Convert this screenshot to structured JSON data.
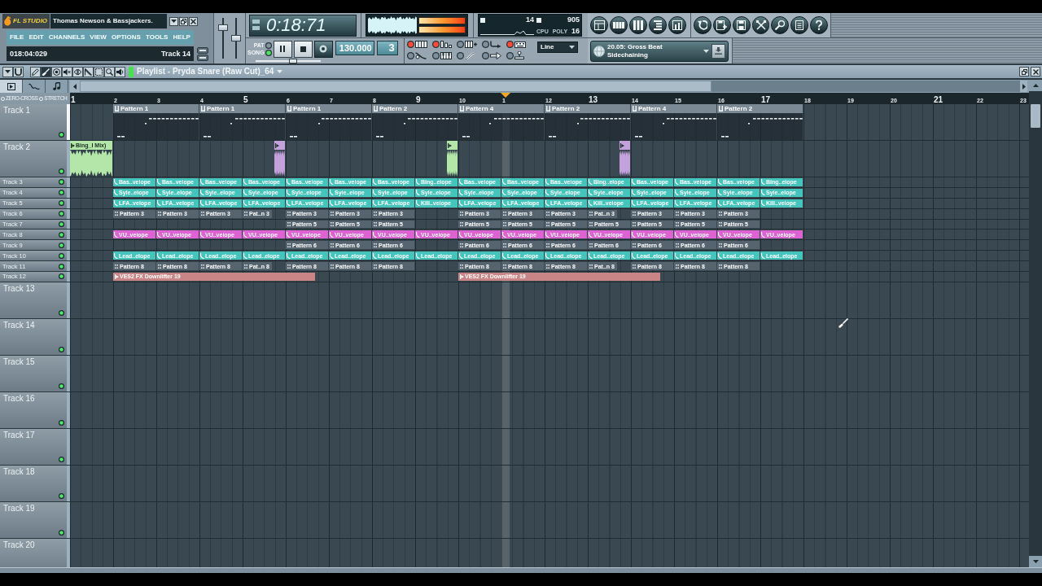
{
  "toolbar": {
    "logo": "FL STUDIO",
    "title": "Thomas Newson & Bassjackers.",
    "menu": [
      "FILE",
      "EDIT",
      "CHANNELS",
      "VIEW",
      "OPTIONS",
      "TOOLS",
      "HELP"
    ],
    "hint": {
      "position": "018:04:029",
      "target": "Track 14"
    },
    "master_sliders": [
      {
        "level": 0.8
      },
      {
        "level": 0.5
      }
    ],
    "time": "0:18:71",
    "meters": [
      {
        "level": 1
      },
      {
        "level": 1
      }
    ],
    "cpu": {
      "load": "14",
      "memory": "905",
      "polyphony": "16",
      "labels": [
        "CPU",
        "POLY"
      ]
    },
    "modes": [
      {
        "label": "PAT",
        "selected": false
      },
      {
        "label": "SONG",
        "selected": true
      }
    ],
    "playing": true,
    "song_slider": {
      "level": 0.58
    },
    "tempo": "130.000",
    "pattern": "3",
    "options": [
      {
        "kind": "metronome",
        "on": true
      },
      {
        "kind": "countdown",
        "on": true
      },
      {
        "kind": "step",
        "on": false
      },
      {
        "kind": "record",
        "on": false
      },
      {
        "kind": "typing",
        "on": true
      },
      {
        "kind": "sweep",
        "on": false
      },
      {
        "kind": "wait",
        "on": false
      },
      {
        "kind": "curve",
        "on": false
      },
      {
        "kind": "loop",
        "on": false
      },
      {
        "kind": "joystick",
        "on": false
      }
    ],
    "snap": "Line",
    "news": [
      "20.05: Gross Beat",
      "Sidechaining"
    ]
  },
  "playlist": {
    "tools": [
      {
        "kind": "draw",
        "selected": false
      },
      {
        "kind": "paint",
        "selected": true
      },
      {
        "kind": "delete",
        "selected": false
      },
      {
        "kind": "mute",
        "selected": false
      },
      {
        "kind": "slip",
        "selected": false
      },
      {
        "kind": "slice",
        "selected": false
      },
      {
        "kind": "select",
        "selected": false
      },
      {
        "kind": "zoom",
        "selected": false
      },
      {
        "kind": "playback",
        "selected": false
      }
    ],
    "title": "Playlist - Pryda Snare (Raw Cut)_64",
    "tabs": [
      {
        "kind": "clips",
        "selected": true
      },
      {
        "kind": "automation",
        "selected": false
      },
      {
        "kind": "notes",
        "selected": false
      }
    ],
    "stretch_options": [
      {
        "label": "ZERO-CROSS",
        "on": false
      },
      {
        "label": "STRETCH",
        "on": false
      }
    ],
    "ruler": [
      "1",
      "2",
      "3",
      "4",
      "5",
      "6",
      "7",
      "8",
      "9",
      "10",
      "1",
      "12",
      "13",
      "14",
      "15",
      "16",
      "17",
      "18",
      "19",
      "20",
      "21",
      "22",
      "23"
    ],
    "playhead": {
      "level": 0.454
    },
    "tracks": [
      {
        "name": "Track 1",
        "compact": false,
        "selected": true,
        "enabled": true,
        "slots": [
          {
            "kind": "empty"
          },
          {
            "kind": "pattern",
            "label": "Pattern 1"
          },
          {
            "kind": "continued"
          },
          {
            "kind": "pattern",
            "label": "Pattern 1"
          },
          {
            "kind": "continued"
          },
          {
            "kind": "pattern",
            "label": "Pattern 1"
          },
          {
            "kind": "continued"
          },
          {
            "kind": "pattern",
            "label": "Pattern 2"
          },
          {
            "kind": "continued"
          },
          {
            "kind": "pattern",
            "label": "Pattern 4"
          },
          {
            "kind": "continued"
          },
          {
            "kind": "pattern",
            "label": "Pattern 2"
          },
          {
            "kind": "continued"
          },
          {
            "kind": "pattern",
            "label": "Pattern 4"
          },
          {
            "kind": "continued"
          },
          {
            "kind": "pattern",
            "label": "Pattern 2"
          },
          {
            "kind": "continued"
          }
        ]
      },
      {
        "name": "Track 2",
        "compact": false,
        "selected": false,
        "enabled": true,
        "slots": [
          {
            "kind": "audio",
            "label": "Bing_I Mix)",
            "color": "#b4e6aa"
          },
          {
            "kind": "empty"
          },
          {
            "kind": "empty"
          },
          {
            "kind": "empty"
          },
          {
            "kind": "tail",
            "color": "#c3a2dc"
          },
          {
            "kind": "empty"
          },
          {
            "kind": "empty"
          },
          {
            "kind": "empty"
          },
          {
            "kind": "tail",
            "color": "#b4e6aa"
          },
          {
            "kind": "empty"
          },
          {
            "kind": "empty"
          },
          {
            "kind": "empty"
          },
          {
            "kind": "tail",
            "color": "#c3a2dc"
          }
        ]
      },
      {
        "name": "Track 3",
        "compact": true,
        "selected": false,
        "enabled": true,
        "slots": [
          {
            "kind": "empty"
          },
          {
            "kind": "automation",
            "label": "Bas..velope",
            "color": "#44c4bb"
          },
          {
            "kind": "automation",
            "label": "Bas..velope",
            "color": "#44c4bb"
          },
          {
            "kind": "automation",
            "label": "Bas..velope",
            "color": "#44c4bb"
          },
          {
            "kind": "automation",
            "label": "Bas..velope",
            "color": "#44c4bb"
          },
          {
            "kind": "automation",
            "label": "Bas..velope",
            "color": "#44c4bb"
          },
          {
            "kind": "automation",
            "label": "Bas..velope",
            "color": "#44c4bb"
          },
          {
            "kind": "automation",
            "label": "Bas..velope",
            "color": "#44c4bb"
          },
          {
            "kind": "automation",
            "label": "Bing..elope",
            "color": "#44c4bb"
          },
          {
            "kind": "automation",
            "label": "Bas..velope",
            "color": "#44c4bb"
          },
          {
            "kind": "automation",
            "label": "Bas..velope",
            "color": "#44c4bb"
          },
          {
            "kind": "automation",
            "label": "Bas..velope",
            "color": "#44c4bb"
          },
          {
            "kind": "automation",
            "label": "Bing..elope",
            "color": "#44c4bb"
          },
          {
            "kind": "automation",
            "label": "Bas..velope",
            "color": "#44c4bb"
          },
          {
            "kind": "automation",
            "label": "Bas..velope",
            "color": "#44c4bb"
          },
          {
            "kind": "automation",
            "label": "Bas..velope",
            "color": "#44c4bb"
          },
          {
            "kind": "automation",
            "label": "Bing..elope",
            "color": "#44c4bb"
          }
        ]
      },
      {
        "name": "Track 4",
        "compact": true,
        "selected": false,
        "enabled": true,
        "slots": [
          {
            "kind": "empty"
          },
          {
            "kind": "automation",
            "label": "Syle..elope",
            "color": "#44c4bb"
          },
          {
            "kind": "automation",
            "label": "Syle..elope",
            "color": "#44c4bb"
          },
          {
            "kind": "automation",
            "label": "Syle..elope",
            "color": "#44c4bb"
          },
          {
            "kind": "automation",
            "label": "Syle..elope",
            "color": "#44c4bb"
          },
          {
            "kind": "automation",
            "label": "Syle..elope",
            "color": "#44c4bb"
          },
          {
            "kind": "automation",
            "label": "Syle..elope",
            "color": "#44c4bb"
          },
          {
            "kind": "automation",
            "label": "Syle..elope",
            "color": "#44c4bb"
          },
          {
            "kind": "automation",
            "label": "Syle..elope",
            "color": "#44c4bb"
          },
          {
            "kind": "automation",
            "label": "Syle..elope",
            "color": "#44c4bb"
          },
          {
            "kind": "automation",
            "label": "Syle..elope",
            "color": "#44c4bb"
          },
          {
            "kind": "automation",
            "label": "Syle..elope",
            "color": "#44c4bb"
          },
          {
            "kind": "automation",
            "label": "Syle..elope",
            "color": "#44c4bb"
          },
          {
            "kind": "automation",
            "label": "Syle..elope",
            "color": "#44c4bb"
          },
          {
            "kind": "automation",
            "label": "Syle..elope",
            "color": "#44c4bb"
          },
          {
            "kind": "automation",
            "label": "Syle..elope",
            "color": "#44c4bb"
          },
          {
            "kind": "automation",
            "label": "Syle..elope",
            "color": "#44c4bb"
          }
        ]
      },
      {
        "name": "Track 5",
        "compact": true,
        "selected": false,
        "enabled": true,
        "slots": [
          {
            "kind": "empty"
          },
          {
            "kind": "automation",
            "label": "LFA..velope",
            "color": "#44c4bb"
          },
          {
            "kind": "automation",
            "label": "LFA..velope",
            "color": "#44c4bb"
          },
          {
            "kind": "automation",
            "label": "LFA..velope",
            "color": "#44c4bb"
          },
          {
            "kind": "automation",
            "label": "LFA..velope",
            "color": "#44c4bb"
          },
          {
            "kind": "automation",
            "label": "LFA..velope",
            "color": "#44c4bb"
          },
          {
            "kind": "automation",
            "label": "LFA..velope",
            "color": "#44c4bb"
          },
          {
            "kind": "automation",
            "label": "LFA..velope",
            "color": "#44c4bb"
          },
          {
            "kind": "automation",
            "label": "Kill..velope",
            "color": "#44c4bb"
          },
          {
            "kind": "automation",
            "label": "LFA..velope",
            "color": "#44c4bb"
          },
          {
            "kind": "automation",
            "label": "LFA..velope",
            "color": "#44c4bb"
          },
          {
            "kind": "automation",
            "label": "LFA..velope",
            "color": "#44c4bb"
          },
          {
            "kind": "automation",
            "label": "Kill..velope",
            "color": "#44c4bb"
          },
          {
            "kind": "automation",
            "label": "LFA..velope",
            "color": "#44c4bb"
          },
          {
            "kind": "automation",
            "label": "LFA..velope",
            "color": "#44c4bb"
          },
          {
            "kind": "automation",
            "label": "LFA..velope",
            "color": "#44c4bb"
          },
          {
            "kind": "automation",
            "label": "Kill..velope",
            "color": "#44c4bb"
          }
        ]
      },
      {
        "name": "Track 6",
        "compact": true,
        "selected": false,
        "enabled": true,
        "slots": [
          {
            "kind": "empty"
          },
          {
            "kind": "pattern",
            "label": "Pattern 3",
            "trimmed": false
          },
          {
            "kind": "pattern",
            "label": "Pattern 3",
            "trimmed": false
          },
          {
            "kind": "pattern",
            "label": "Pattern 3",
            "trimmed": false
          },
          {
            "kind": "pattern",
            "label": "Pat..n 3",
            "trimmed": true
          },
          {
            "kind": "pattern",
            "label": "Pattern 3",
            "trimmed": false
          },
          {
            "kind": "pattern",
            "label": "Pattern 3",
            "trimmed": false
          },
          {
            "kind": "pattern",
            "label": "Pattern 3",
            "trimmed": false
          },
          {
            "kind": "empty"
          },
          {
            "kind": "pattern",
            "label": "Pattern 3",
            "trimmed": false
          },
          {
            "kind": "pattern",
            "label": "Pattern 3",
            "trimmed": false
          },
          {
            "kind": "pattern",
            "label": "Pattern 3",
            "trimmed": false
          },
          {
            "kind": "pattern",
            "label": "Pat..n 3",
            "trimmed": true
          },
          {
            "kind": "pattern",
            "label": "Pattern 3",
            "trimmed": false
          },
          {
            "kind": "pattern",
            "label": "Pattern 3",
            "trimmed": false
          },
          {
            "kind": "pattern",
            "label": "Pattern 3",
            "trimmed": false
          }
        ]
      },
      {
        "name": "Track 7",
        "compact": true,
        "selected": false,
        "enabled": true,
        "slots": [
          {
            "kind": "empty"
          },
          {
            "kind": "empty"
          },
          {
            "kind": "empty"
          },
          {
            "kind": "empty"
          },
          {
            "kind": "empty"
          },
          {
            "kind": "pattern",
            "label": "Pattern 5"
          },
          {
            "kind": "pattern",
            "label": "Pattern 5"
          },
          {
            "kind": "pattern",
            "label": "Pattern 5"
          },
          {
            "kind": "empty"
          },
          {
            "kind": "pattern",
            "label": "Pattern 5"
          },
          {
            "kind": "pattern",
            "label": "Pattern 5"
          },
          {
            "kind": "pattern",
            "label": "Pattern 5"
          },
          {
            "kind": "pattern",
            "label": "Pattern 5"
          },
          {
            "kind": "pattern",
            "label": "Pattern 5"
          },
          {
            "kind": "pattern",
            "label": "Pattern 5"
          },
          {
            "kind": "pattern",
            "label": "Pattern 5"
          }
        ]
      },
      {
        "name": "Track 8",
        "compact": true,
        "selected": false,
        "enabled": true,
        "slots": [
          {
            "kind": "empty"
          },
          {
            "kind": "automation",
            "label": "VU..velope",
            "color": "#dd62d2"
          },
          {
            "kind": "automation",
            "label": "VU..velope",
            "color": "#dd62d2"
          },
          {
            "kind": "automation",
            "label": "VU..velope",
            "color": "#dd62d2"
          },
          {
            "kind": "automation",
            "label": "VU..velope",
            "color": "#dd62d2"
          },
          {
            "kind": "automation",
            "label": "VU..velope",
            "color": "#dd62d2"
          },
          {
            "kind": "automation",
            "label": "VU..velope",
            "color": "#dd62d2"
          },
          {
            "kind": "automation",
            "label": "VU..velope",
            "color": "#dd62d2"
          },
          {
            "kind": "automation",
            "label": "VU..velope",
            "color": "#dd62d2"
          },
          {
            "kind": "automation",
            "label": "VU..velope",
            "color": "#dd62d2"
          },
          {
            "kind": "automation",
            "label": "VU..velope",
            "color": "#dd62d2"
          },
          {
            "kind": "automation",
            "label": "VU..velope",
            "color": "#dd62d2"
          },
          {
            "kind": "automation",
            "label": "VU..velope",
            "color": "#dd62d2"
          },
          {
            "kind": "automation",
            "label": "VU..velope",
            "color": "#dd62d2"
          },
          {
            "kind": "automation",
            "label": "VU..velope",
            "color": "#dd62d2"
          },
          {
            "kind": "automation",
            "label": "VU..velope",
            "color": "#dd62d2"
          },
          {
            "kind": "automation",
            "label": "VU..velope",
            "color": "#dd62d2"
          }
        ]
      },
      {
        "name": "Track 9",
        "compact": true,
        "selected": false,
        "enabled": true,
        "slots": [
          {
            "kind": "empty"
          },
          {
            "kind": "empty"
          },
          {
            "kind": "empty"
          },
          {
            "kind": "empty"
          },
          {
            "kind": "empty"
          },
          {
            "kind": "pattern",
            "label": "Pattern 6"
          },
          {
            "kind": "pattern",
            "label": "Pattern 6"
          },
          {
            "kind": "pattern",
            "label": "Pattern 6"
          },
          {
            "kind": "empty"
          },
          {
            "kind": "pattern",
            "label": "Pattern 6"
          },
          {
            "kind": "pattern",
            "label": "Pattern 6"
          },
          {
            "kind": "pattern",
            "label": "Pattern 6"
          },
          {
            "kind": "pattern",
            "label": "Pattern 6"
          },
          {
            "kind": "pattern",
            "label": "Pattern 6"
          },
          {
            "kind": "pattern",
            "label": "Pattern 6"
          },
          {
            "kind": "pattern",
            "label": "Pattern 6"
          }
        ]
      },
      {
        "name": "Track 10",
        "compact": true,
        "selected": false,
        "enabled": true,
        "slots": [
          {
            "kind": "empty"
          },
          {
            "kind": "automation",
            "label": "Lead..elope",
            "color": "#44c4bb"
          },
          {
            "kind": "automation",
            "label": "Lead..elope",
            "color": "#44c4bb"
          },
          {
            "kind": "automation",
            "label": "Lead..elope",
            "color": "#44c4bb"
          },
          {
            "kind": "automation",
            "label": "Lead..elope",
            "color": "#44c4bb"
          },
          {
            "kind": "automation",
            "label": "Lead..elope",
            "color": "#44c4bb"
          },
          {
            "kind": "automation",
            "label": "Lead..elope",
            "color": "#44c4bb"
          },
          {
            "kind": "automation",
            "label": "Lead..elope",
            "color": "#44c4bb"
          },
          {
            "kind": "automation",
            "label": "Lead..elope",
            "color": "#44c4bb"
          },
          {
            "kind": "automation",
            "label": "Lead..elope",
            "color": "#44c4bb"
          },
          {
            "kind": "automation",
            "label": "Lead..elope",
            "color": "#44c4bb"
          },
          {
            "kind": "automation",
            "label": "Lead..elope",
            "color": "#44c4bb"
          },
          {
            "kind": "automation",
            "label": "Lead..elope",
            "color": "#44c4bb"
          },
          {
            "kind": "automation",
            "label": "Lead..elope",
            "color": "#44c4bb"
          },
          {
            "kind": "automation",
            "label": "Lead..elope",
            "color": "#44c4bb"
          },
          {
            "kind": "automation",
            "label": "Lead..elope",
            "color": "#44c4bb"
          },
          {
            "kind": "automation",
            "label": "Lead..elope",
            "color": "#44c4bb"
          }
        ]
      },
      {
        "name": "Track 11",
        "compact": true,
        "selected": false,
        "enabled": true,
        "slots": [
          {
            "kind": "empty"
          },
          {
            "kind": "pattern",
            "label": "Pattern 8",
            "trimmed": false
          },
          {
            "kind": "pattern",
            "label": "Pattern 8",
            "trimmed": false
          },
          {
            "kind": "pattern",
            "label": "Pattern 8",
            "trimmed": false
          },
          {
            "kind": "pattern",
            "label": "Pat..n 8",
            "trimmed": true
          },
          {
            "kind": "pattern",
            "label": "Pattern 8",
            "trimmed": false
          },
          {
            "kind": "pattern",
            "label": "Pattern 8",
            "trimmed": false
          },
          {
            "kind": "pattern",
            "label": "Pattern 8",
            "trimmed": false
          },
          {
            "kind": "empty"
          },
          {
            "kind": "pattern",
            "label": "Pattern 8",
            "trimmed": false
          },
          {
            "kind": "pattern",
            "label": "Pattern 8",
            "trimmed": false
          },
          {
            "kind": "pattern",
            "label": "Pattern 8",
            "trimmed": false
          },
          {
            "kind": "pattern",
            "label": "Pat..n 8",
            "trimmed": true
          },
          {
            "kind": "pattern",
            "label": "Pattern 8",
            "trimmed": false
          },
          {
            "kind": "pattern",
            "label": "Pattern 8",
            "trimmed": false
          },
          {
            "kind": "pattern",
            "label": "Pattern 8",
            "trimmed": false
          }
        ]
      },
      {
        "name": "Track 12",
        "compact": true,
        "selected": false,
        "enabled": true,
        "slots": [
          {
            "kind": "empty"
          },
          {
            "kind": "audio",
            "label": "VES2 FX Downlifter 19",
            "color": "#c98585",
            "trimmed": true
          },
          {
            "kind": "continued"
          },
          {
            "kind": "continued"
          },
          {
            "kind": "continued"
          },
          {
            "kind": "continued"
          },
          {
            "kind": "empty"
          },
          {
            "kind": "empty"
          },
          {
            "kind": "empty"
          },
          {
            "kind": "audio",
            "label": "VES2 FX Downlifter 19",
            "color": "#c98585",
            "trimmed": true
          },
          {
            "kind": "continued"
          },
          {
            "kind": "continued"
          },
          {
            "kind": "continued"
          },
          {
            "kind": "continued"
          }
        ]
      },
      {
        "name": "Track 13",
        "compact": false,
        "selected": false,
        "enabled": true
      },
      {
        "name": "Track 14",
        "compact": false,
        "selected": false,
        "enabled": true
      },
      {
        "name": "Track 15",
        "compact": false,
        "selected": false,
        "enabled": true
      },
      {
        "name": "Track 16",
        "compact": false,
        "selected": false,
        "enabled": true
      },
      {
        "name": "Track 17",
        "compact": false,
        "selected": false,
        "enabled": true
      },
      {
        "name": "Track 18",
        "compact": false,
        "selected": false,
        "enabled": true
      },
      {
        "name": "Track 19",
        "compact": false,
        "selected": false,
        "enabled": true
      },
      {
        "name": "Track 20",
        "compact": false,
        "selected": false
      }
    ]
  }
}
